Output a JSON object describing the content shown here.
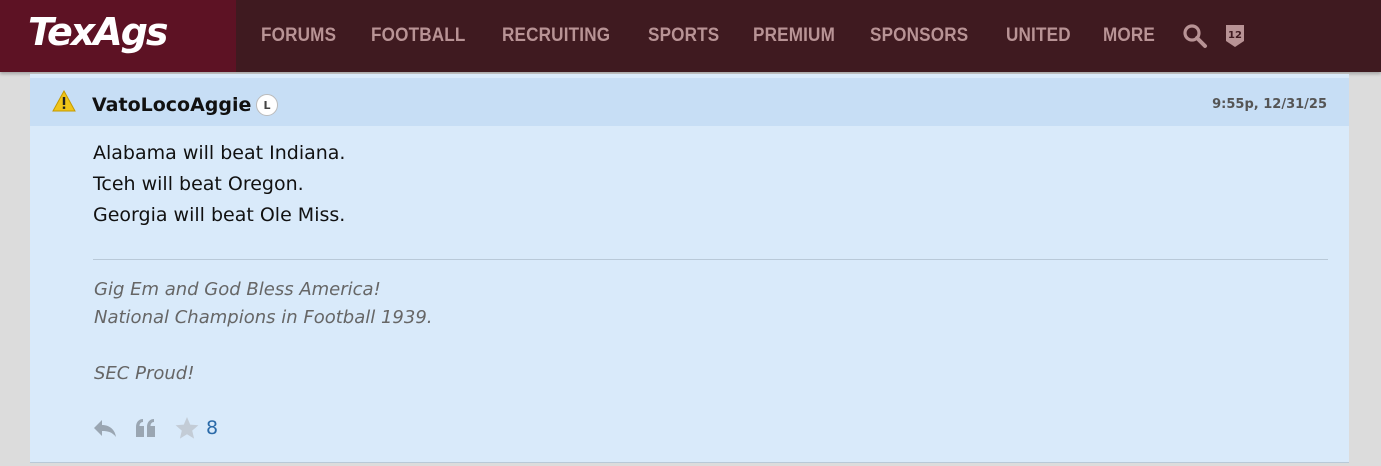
{
  "site": {
    "logo": "TexAgs"
  },
  "nav": {
    "items": [
      "FORUMS",
      "FOOTBALL",
      "RECRUITING",
      "SPORTS",
      "PREMIUM",
      "SPONSORS",
      "UNITED",
      "MORE"
    ],
    "search_icon": "search-icon",
    "twelfth_man_badge": "12"
  },
  "post": {
    "status_icon": "warning-icon",
    "username": "VatoLocoAggie",
    "badge": "L",
    "timestamp": "9:55p, 12/31/25",
    "lines": [
      "Alabama will beat Indiana.",
      "Tceh will beat Oregon.",
      "Georgia will beat Ole Miss."
    ],
    "signature": [
      "Gig Em and God Bless America!",
      "National Champions in Football 1939.",
      "SEC Proud!"
    ],
    "actions": {
      "reply_icon": "reply-icon",
      "quote_icon": "quote-icon",
      "star_icon": "star-icon",
      "star_count": "8"
    }
  },
  "colors": {
    "nav_bg": "#3f1a20",
    "logo_bg": "#5d1224",
    "nav_text": "#b89395",
    "post_bg": "#d9eafa",
    "post_header_bg": "#c7def5",
    "star_count": "#2a6aa8"
  }
}
